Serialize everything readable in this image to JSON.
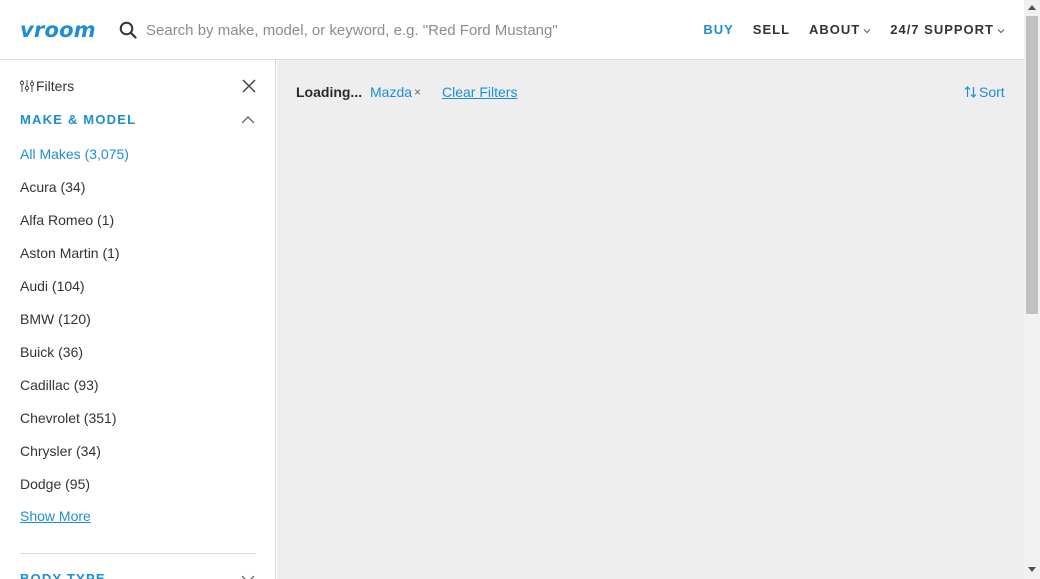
{
  "header": {
    "logo": "vroom",
    "search_placeholder": "Search by make, model, or keyword, e.g. \"Red Ford Mustang\"",
    "nav": [
      {
        "label": "BUY",
        "active": true,
        "dropdown": false
      },
      {
        "label": "SELL",
        "active": false,
        "dropdown": false
      },
      {
        "label": "ABOUT",
        "active": false,
        "dropdown": true
      },
      {
        "label": "24/7 SUPPORT",
        "active": false,
        "dropdown": true
      }
    ]
  },
  "sidebar": {
    "title": "Filters",
    "section_make": {
      "title": "MAKE & MODEL",
      "items": [
        {
          "label": "All Makes (3,075)",
          "active": true
        },
        {
          "label": "Acura (34)",
          "active": false
        },
        {
          "label": "Alfa Romeo (1)",
          "active": false
        },
        {
          "label": "Aston Martin (1)",
          "active": false
        },
        {
          "label": "Audi (104)",
          "active": false
        },
        {
          "label": "BMW (120)",
          "active": false
        },
        {
          "label": "Buick (36)",
          "active": false
        },
        {
          "label": "Cadillac (93)",
          "active": false
        },
        {
          "label": "Chevrolet (351)",
          "active": false
        },
        {
          "label": "Chrysler (34)",
          "active": false
        },
        {
          "label": "Dodge (95)",
          "active": false
        }
      ],
      "show_more": "Show More"
    },
    "section_body": {
      "title": "BODY TYPE"
    }
  },
  "main": {
    "status": "Loading...",
    "chip": {
      "label": "Mazda",
      "remove": "×"
    },
    "clear_filters": "Clear Filters",
    "sort": "Sort"
  },
  "colors": {
    "accent": "#1d8ed3",
    "main_bg": "#eeeeee",
    "text": "#2b2b2b"
  },
  "icons": [
    "search-icon",
    "filters-icon",
    "close-icon",
    "chevron-up-icon",
    "chevron-down-icon",
    "sort-icon"
  ]
}
